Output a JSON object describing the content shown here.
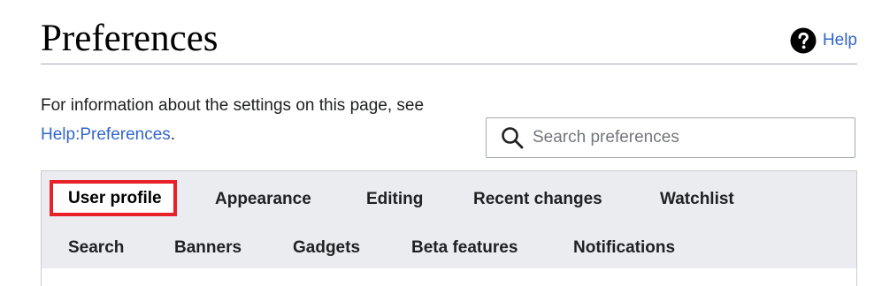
{
  "page": {
    "title": "Preferences",
    "help_label": "Help"
  },
  "intro": {
    "text_before": "For information about the settings on this page, see",
    "link_label": "Help:Preferences",
    "text_after": "."
  },
  "search": {
    "placeholder": "Search preferences",
    "value": ""
  },
  "tabs": {
    "row1": [
      {
        "label": "User profile",
        "active": true
      },
      {
        "label": "Appearance",
        "active": false
      },
      {
        "label": "Editing",
        "active": false
      },
      {
        "label": "Recent changes",
        "active": false
      },
      {
        "label": "Watchlist",
        "active": false
      }
    ],
    "row2": [
      {
        "label": "Search",
        "active": false
      },
      {
        "label": "Banners",
        "active": false
      },
      {
        "label": "Gadgets",
        "active": false
      },
      {
        "label": "Beta features",
        "active": false
      },
      {
        "label": "Notifications",
        "active": false
      }
    ]
  },
  "colors": {
    "link": "#3366cc",
    "tab_bar_bg": "#eaecf0",
    "active_tab_highlight": "#e8202a"
  },
  "icons": {
    "help": "help-question-circle-icon",
    "search": "magnifier-icon"
  }
}
